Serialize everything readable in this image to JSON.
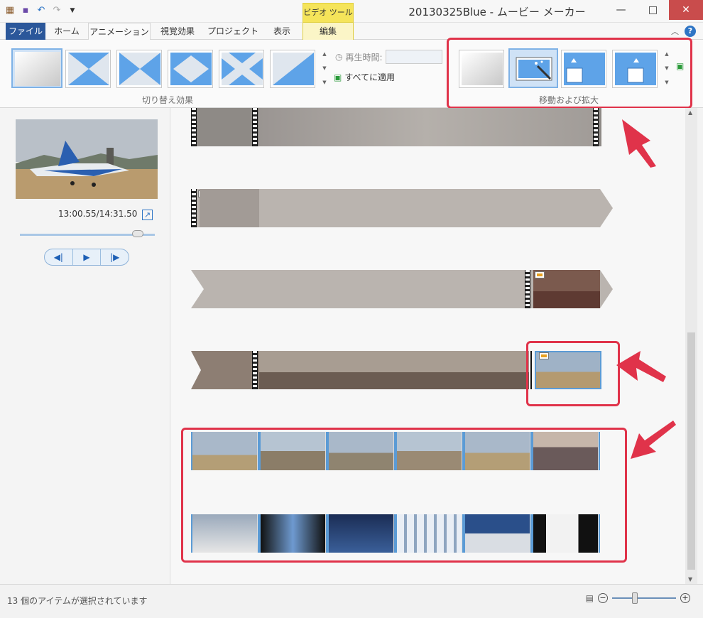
{
  "window": {
    "title": "20130325Blue - ムービー メーカー",
    "minimize": "—",
    "maximize": "□",
    "close": "✕"
  },
  "qat": {
    "app_icon": "film-icon",
    "save": "save-icon",
    "undo": "undo-icon",
    "redo": "redo-icon",
    "menu": "dropdown-icon"
  },
  "context_tab_header": "ビデオ ツール",
  "tabs": [
    {
      "label": "ファイル"
    },
    {
      "label": "ホーム"
    },
    {
      "label": "アニメーション"
    },
    {
      "label": "視覚効果"
    },
    {
      "label": "プロジェクト"
    },
    {
      "label": "表示"
    },
    {
      "label": "編集"
    }
  ],
  "ribbon": {
    "transitions_label": "切り替え効果",
    "play_time_label": "再生時間:",
    "apply_all_label": "すべてに適用",
    "pan_zoom_label": "移動および拡大"
  },
  "preview": {
    "time": "13:00.55/14:31.50",
    "seek_fraction": 0.9
  },
  "status": {
    "text": "13 個のアイテムが選択されています"
  },
  "colors": {
    "accent": "#2b579a",
    "context_tab": "#f5e45a",
    "highlight": "#e0334a",
    "selection": "#5b9bd5"
  }
}
